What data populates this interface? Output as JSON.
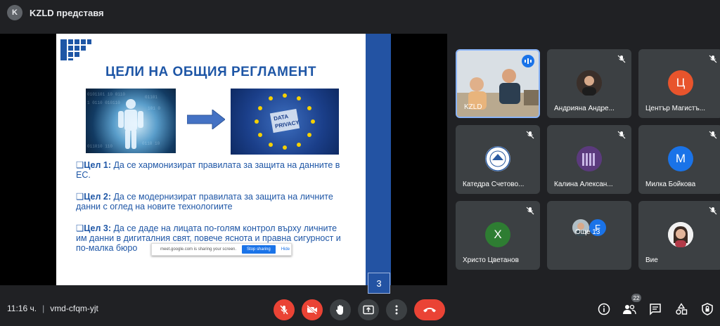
{
  "header": {
    "avatar_letter": "K",
    "presenter_label": "KZLD представя"
  },
  "slide": {
    "title": "ЦЕЛИ НА ОБЩИЯ РЕГЛАМЕНТ",
    "image_right_text_1": "DATA",
    "image_right_text_2": "PRIVACY",
    "bullets": [
      {
        "label": "Цел 1:",
        "text": " Да се хармонизират правилата за защита на данните в ЕС."
      },
      {
        "label": "Цел 2:",
        "text": " Да се модернизират правилата за защита на личните данни с оглед на новите технологиите"
      },
      {
        "label": "Цел 3:",
        "text": " Да се даде на лицата по-голям контрол върху личните им данни в дигиталния свят, повече яснота и правна сигурност и по-малка бюро"
      }
    ],
    "page_number": "3",
    "share_notice": "meet.google.com is sharing your screen.",
    "stop_sharing": "Stop sharing",
    "hide": "Hide"
  },
  "participants": [
    {
      "name": "KZLD",
      "type": "video"
    },
    {
      "name": "Андрияна Андре...",
      "type": "photo"
    },
    {
      "name": "Център Магистъ...",
      "type": "letter",
      "letter": "Ц",
      "color": "#e8542c"
    },
    {
      "name": "Катедра Счетово...",
      "type": "logo"
    },
    {
      "name": "Калина Алексан...",
      "type": "photo"
    },
    {
      "name": "Милка Бойкова",
      "type": "letter",
      "letter": "М",
      "color": "#1a73e8"
    },
    {
      "name": "Христо Цветанов",
      "type": "letter",
      "letter": "Х",
      "color": "#2e7d32"
    },
    {
      "name": "Още 13",
      "type": "group",
      "letter": "F"
    },
    {
      "name": "Вие",
      "type": "photo"
    }
  ],
  "footer": {
    "time": "11:16 ч.",
    "separator": "|",
    "meeting_code": "vmd-cfqm-yjt",
    "participants_count": "22"
  }
}
